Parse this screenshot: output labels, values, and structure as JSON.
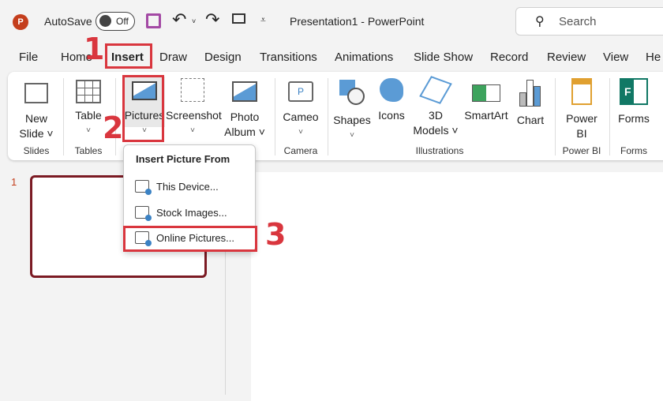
{
  "titlebar": {
    "autosave_label": "AutoSave",
    "autosave_state": "Off",
    "title": "Presentation1  -  PowerPoint",
    "search_placeholder": "Search"
  },
  "tabs": [
    "File",
    "Home",
    "Insert",
    "Draw",
    "Design",
    "Transitions",
    "Animations",
    "Slide Show",
    "Record",
    "Review",
    "View",
    "He"
  ],
  "active_tab": "Insert",
  "ribbon": {
    "buttons": [
      {
        "id": "new-slide",
        "line1": "New",
        "line2": "Slide ˅"
      },
      {
        "id": "table",
        "line1": "Table",
        "line2": "˅"
      },
      {
        "id": "pictures",
        "line1": "Pictures",
        "line2": "˅"
      },
      {
        "id": "screenshot",
        "line1": "Screenshot",
        "line2": "˅"
      },
      {
        "id": "photo-album",
        "line1": "Photo",
        "line2": "Album ˅"
      },
      {
        "id": "cameo",
        "line1": "Cameo",
        "line2": "˅"
      },
      {
        "id": "shapes",
        "line1": "Shapes",
        "line2": "˅"
      },
      {
        "id": "icons",
        "line1": "Icons",
        "line2": ""
      },
      {
        "id": "3d-models",
        "line1": "3D",
        "line2": "Models ˅"
      },
      {
        "id": "smartart",
        "line1": "SmartArt",
        "line2": ""
      },
      {
        "id": "chart",
        "line1": "Chart",
        "line2": ""
      },
      {
        "id": "power-bi",
        "line1": "Power",
        "line2": "BI"
      },
      {
        "id": "forms",
        "line1": "Forms",
        "line2": ""
      }
    ],
    "groups": [
      "Slides",
      "Tables",
      "Camera",
      "Illustrations",
      "Power BI",
      "Forms"
    ]
  },
  "dropdown": {
    "title": "Insert Picture From",
    "items": [
      "This Device...",
      "Stock Images...",
      "Online Pictures..."
    ]
  },
  "slide_panel": {
    "slide_number": "1"
  },
  "annotations": [
    "1",
    "2",
    "3"
  ],
  "colors": {
    "annotation": "#d9363e",
    "accent": "#c43e1c"
  }
}
